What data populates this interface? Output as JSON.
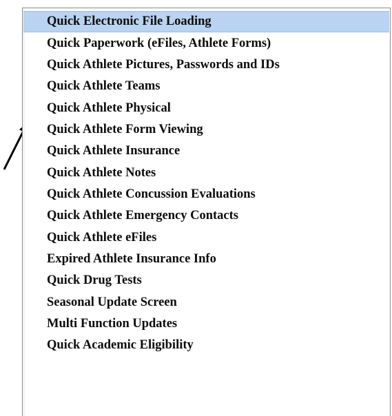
{
  "menu": {
    "items": [
      {
        "label": "Quick Electronic File Loading",
        "selected": true
      },
      {
        "label": "Quick Paperwork (eFiles, Athlete Forms)",
        "selected": false
      },
      {
        "label": "Quick Athlete Pictures, Passwords and IDs",
        "selected": false
      },
      {
        "label": "Quick Athlete Teams",
        "selected": false
      },
      {
        "label": "Quick Athlete Physical",
        "selected": false
      },
      {
        "label": "Quick Athlete Form Viewing",
        "selected": false
      },
      {
        "label": "Quick Athlete Insurance",
        "selected": false
      },
      {
        "label": "Quick Athlete Notes",
        "selected": false
      },
      {
        "label": "Quick Athlete Concussion Evaluations",
        "selected": false
      },
      {
        "label": "Quick Athlete Emergency Contacts",
        "selected": false
      },
      {
        "label": "Quick Athlete eFiles",
        "selected": false
      },
      {
        "label": "Expired Athlete Insurance Info",
        "selected": false
      },
      {
        "label": "Quick Drug Tests",
        "selected": false
      },
      {
        "label": "Seasonal Update Screen",
        "selected": false
      },
      {
        "label": "Multi Function Updates",
        "selected": false
      },
      {
        "label": "Quick Academic Eligibility",
        "selected": false
      }
    ]
  },
  "colors": {
    "selected_background": "#b9d3f0",
    "text": "#0b0b0b",
    "arrow": "#000000"
  },
  "icons": {
    "pointer": "arrow-icon"
  }
}
